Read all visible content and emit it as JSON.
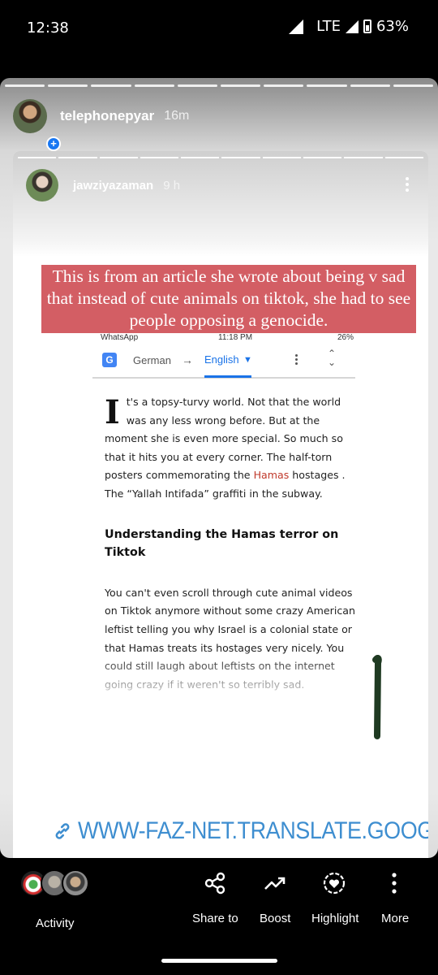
{
  "status_bar": {
    "time": "12:38",
    "network": "LTE",
    "battery": "63%"
  },
  "outer_story": {
    "username": "telephonepyar",
    "time_ago": "16m"
  },
  "inner_story": {
    "username": "jawziyazaman",
    "time_ago": "9 h",
    "caption": "This is from an article she wrote about being v sad that instead of cute animals on tiktok, she had to see people opposing a genocide.",
    "screenshot": {
      "status_left": "WhatsApp",
      "status_mid": "11:18 PM",
      "status_right": "26%",
      "translate": {
        "from_lang": "German",
        "arrow": "→",
        "to_lang": "English"
      },
      "article": {
        "drop_cap": "I",
        "para1_a": "t's a topsy-turvy world. Not that the world was any less wrong before. But at the moment she is even more special. So much so that it hits you at every corner. The half-torn posters commemorating the ",
        "para1_link": "Hamas",
        "para1_b": " hostages . The “Yallah Intifada” graffiti in the subway.",
        "heading": "Understanding the Hamas terror on Tiktok",
        "para2": "You can't even scroll through cute animal videos on Tiktok anymore without some crazy American leftist telling you why Israel is a colonial state or that Hamas treats its hostages very nicely. You could still laugh about leftists on the internet going crazy if it weren't so terribly sad."
      }
    },
    "link_sticker": "WWW-FAZ-NET.TRANSLATE.GOOG"
  },
  "bottom_bar": {
    "activity": "Activity",
    "share": "Share to",
    "boost": "Boost",
    "highlight": "Highlight",
    "more": "More"
  },
  "icons": {
    "share": "share-icon",
    "boost": "trending-up-icon",
    "highlight": "heart-circle-icon",
    "more": "more-vertical-icon",
    "link": "link-icon"
  },
  "colors": {
    "caption_bg": "#d35e64",
    "link_blue": "#3e8ed0",
    "translate_blue": "#1a73e8",
    "hamas_link": "#c0392b",
    "marker": "#1f3a22"
  }
}
